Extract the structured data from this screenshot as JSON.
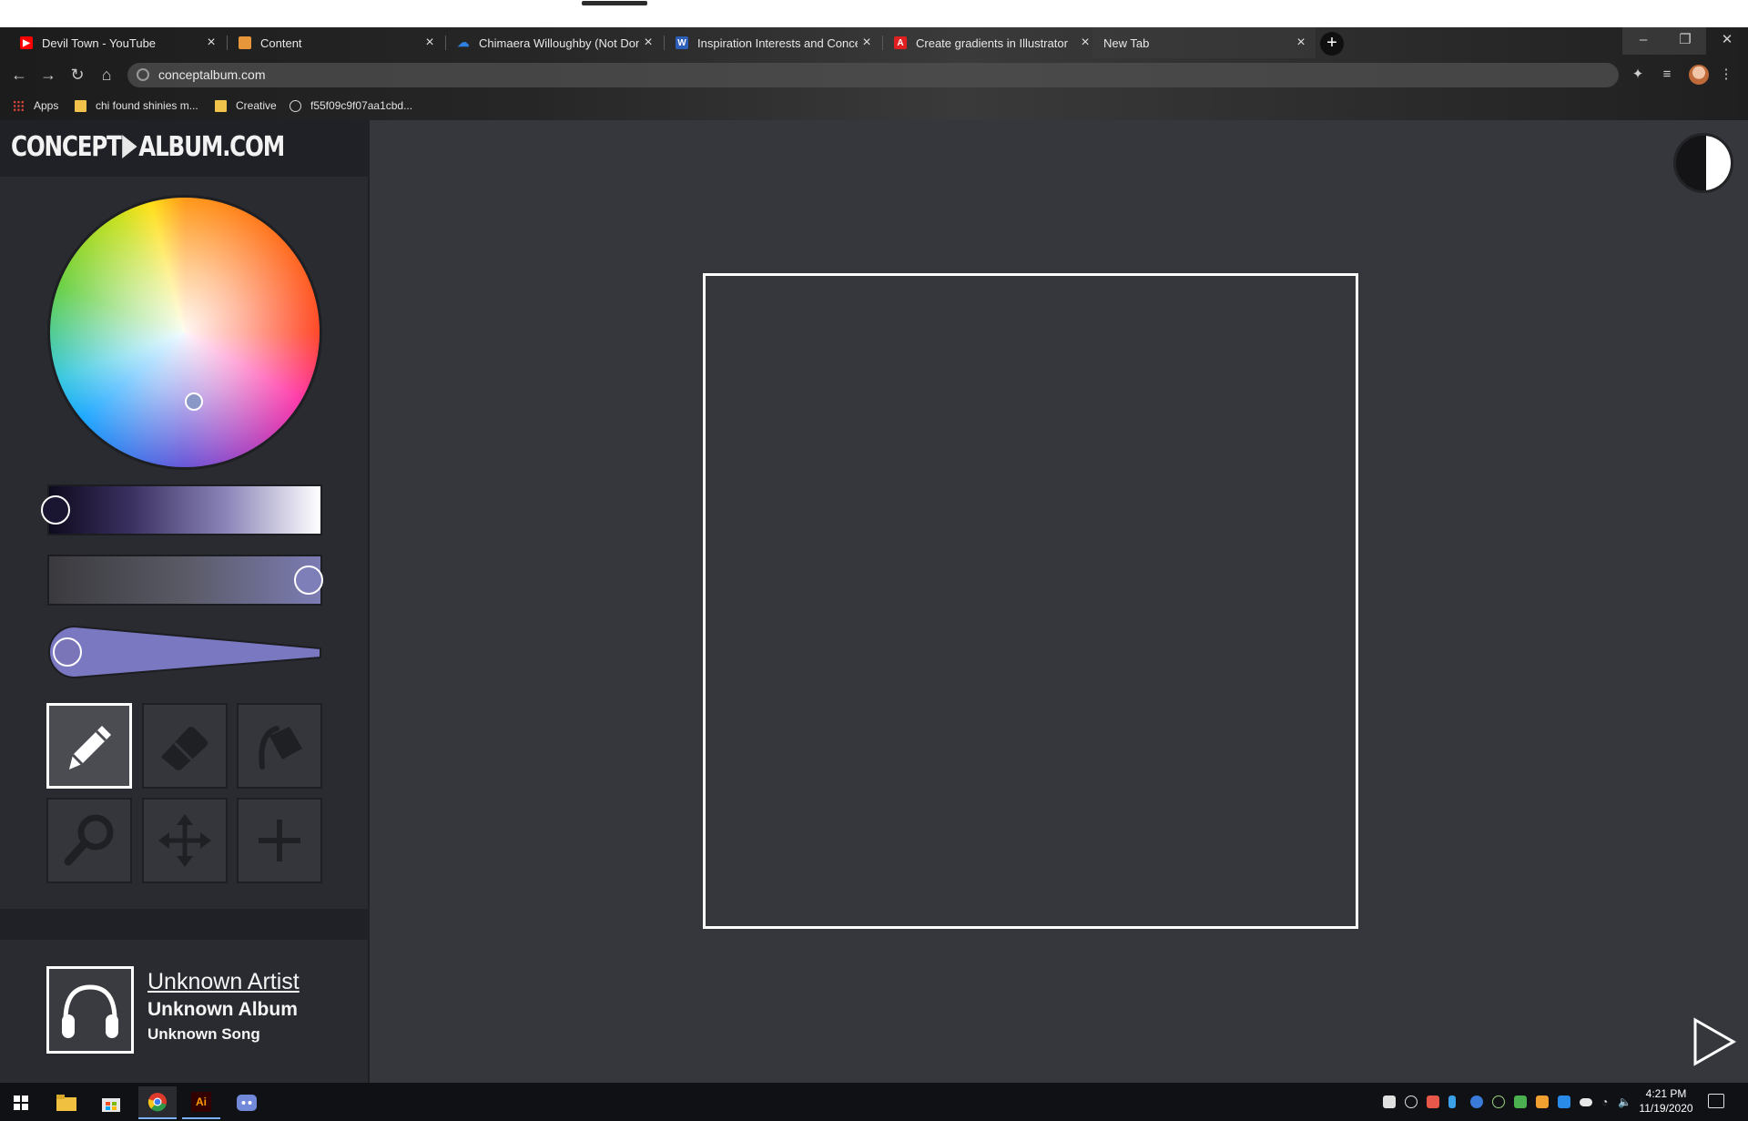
{
  "browser": {
    "tabs": [
      {
        "label": "Devil Town - YouTube",
        "favicon": "youtube-icon",
        "color": "#ff0000"
      },
      {
        "label": "Content",
        "favicon": "content-icon",
        "color": "#e8963a"
      },
      {
        "label": "Chimaera Willoughby (Not Done",
        "favicon": "onedrive-icon",
        "color": "#2f7fe0"
      },
      {
        "label": "Inspiration Interests and Concept",
        "favicon": "word-icon",
        "color": "#2b5fb8"
      },
      {
        "label": "Create gradients in Illustrator",
        "favicon": "adobe-icon",
        "color": "#e02020"
      },
      {
        "label": "New Tab",
        "favicon": "",
        "color": ""
      }
    ],
    "url": "conceptalbum.com",
    "bookmarks": [
      {
        "label": "Apps",
        "icon": "apps-icon"
      },
      {
        "label": "chi found shinies m...",
        "icon": "folder-icon"
      },
      {
        "label": "Creative",
        "icon": "folder-icon"
      },
      {
        "label": "f55f09c9f07aa1cbd...",
        "icon": "globe-icon"
      }
    ]
  },
  "app": {
    "logo": {
      "left": "CONCEPT",
      "right": "ALBUM.COM"
    },
    "sliders": {
      "lightness": 0.0,
      "saturation": 1.0,
      "brush_size": 0.0
    },
    "tools": [
      {
        "name": "pencil",
        "active": true
      },
      {
        "name": "eraser",
        "active": false
      },
      {
        "name": "bucket",
        "active": false
      },
      {
        "name": "zoom",
        "active": false
      },
      {
        "name": "move",
        "active": false
      },
      {
        "name": "add",
        "active": false
      }
    ],
    "track": {
      "artist": "Unknown Artist",
      "album": "Unknown Album",
      "song": "Unknown Song"
    },
    "colors": {
      "background": "#35373d",
      "sidebar": "#2a2b30",
      "accent": "#7a7ab8"
    }
  },
  "taskbar": {
    "time": "4:21 PM",
    "date": "11/19/2020",
    "apps": [
      "start-icon",
      "file-explorer-icon",
      "store-icon",
      "chrome-icon",
      "illustrator-icon",
      "discord-icon"
    ],
    "illustrator_label": "Ai"
  }
}
